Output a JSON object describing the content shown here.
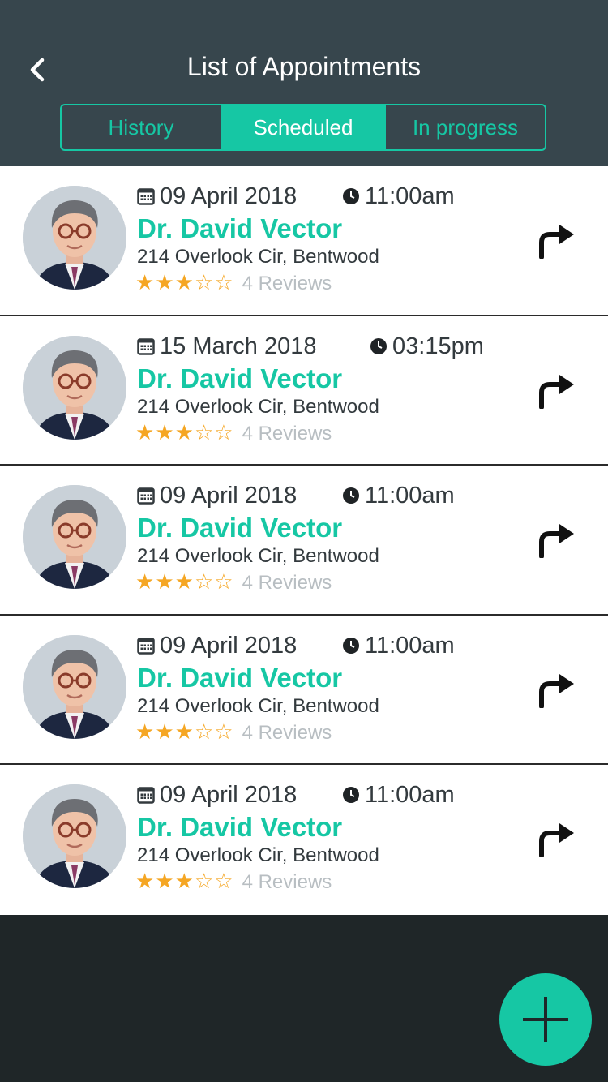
{
  "header": {
    "title": "List of Appointments"
  },
  "tabs": [
    {
      "label": "History",
      "active": false
    },
    {
      "label": "Scheduled",
      "active": true
    },
    {
      "label": "In progress",
      "active": false
    }
  ],
  "appointments": [
    {
      "date": "09 April 2018",
      "time": "11:00am",
      "doctor": "Dr. David Vector",
      "address": "214 Overlook Cir, Bentwood",
      "rating": 3,
      "max_rating": 5,
      "reviews": "4 Reviews"
    },
    {
      "date": "15 March 2018",
      "time": "03:15pm",
      "doctor": "Dr. David Vector",
      "address": "214 Overlook Cir, Bentwood",
      "rating": 3,
      "max_rating": 5,
      "reviews": "4 Reviews"
    },
    {
      "date": "09 April 2018",
      "time": "11:00am",
      "doctor": "Dr. David Vector",
      "address": "214 Overlook Cir, Bentwood",
      "rating": 3,
      "max_rating": 5,
      "reviews": "4 Reviews"
    },
    {
      "date": "09 April 2018",
      "time": "11:00am",
      "doctor": "Dr. David Vector",
      "address": "214 Overlook Cir, Bentwood",
      "rating": 3,
      "max_rating": 5,
      "reviews": "4 Reviews"
    },
    {
      "date": "09 April 2018",
      "time": "11:00am",
      "doctor": "Dr. David Vector",
      "address": "214 Overlook Cir, Bentwood",
      "rating": 3,
      "max_rating": 5,
      "reviews": "4 Reviews"
    }
  ],
  "icons": {
    "back": "chevron-left-icon",
    "date": "calendar-icon",
    "time": "clock-icon",
    "go": "turn-right-arrow-icon",
    "add": "plus-icon"
  },
  "colors": {
    "header_bg": "#37464d",
    "accent": "#16c7a4",
    "footer_bg": "#1f2628",
    "star": "#f5a623"
  }
}
